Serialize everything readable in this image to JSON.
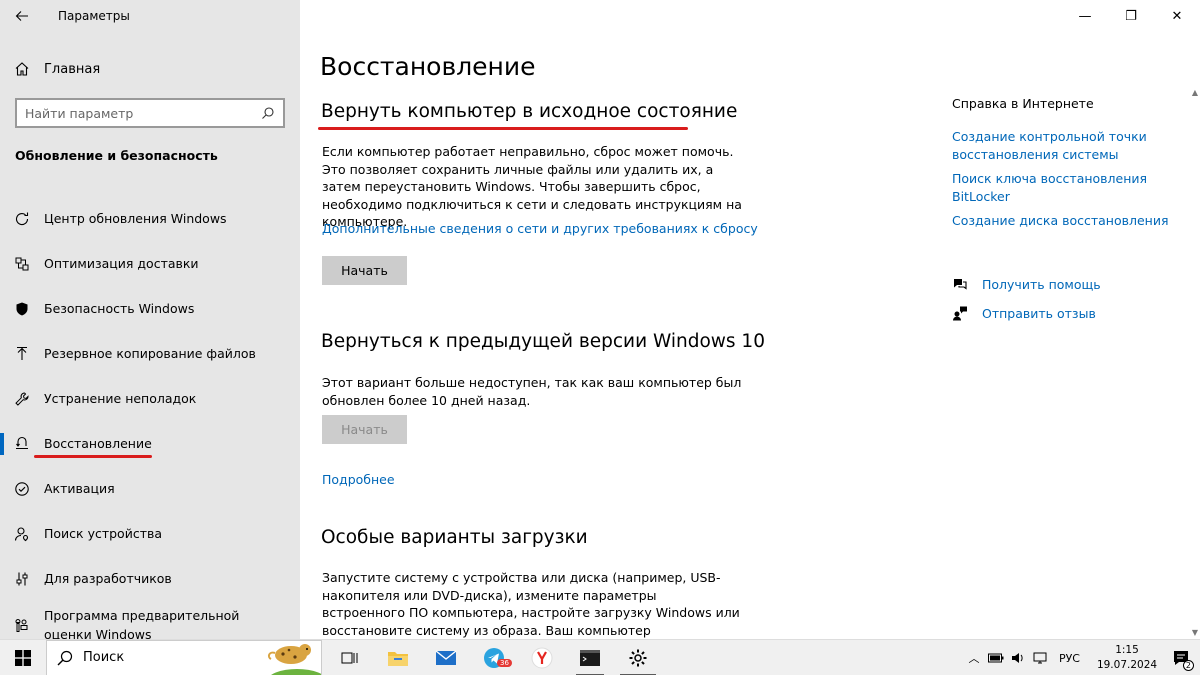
{
  "window": {
    "title": "Параметры",
    "controls": {
      "minimize": "—",
      "restore": "❐",
      "close": "✕"
    }
  },
  "sidebar": {
    "home_label": "Главная",
    "search_placeholder": "Найти параметр",
    "section_heading": "Обновление и безопасность",
    "items": [
      {
        "label": "Центр обновления Windows",
        "icon": "refresh-icon"
      },
      {
        "label": "Оптимизация доставки",
        "icon": "delivery-icon"
      },
      {
        "label": "Безопасность Windows",
        "icon": "shield-icon"
      },
      {
        "label": "Резервное копирование файлов",
        "icon": "backup-icon"
      },
      {
        "label": "Устранение неполадок",
        "icon": "wrench-icon"
      },
      {
        "label": "Восстановление",
        "icon": "recovery-icon",
        "active": true
      },
      {
        "label": "Активация",
        "icon": "check-circle-icon"
      },
      {
        "label": "Поиск устройства",
        "icon": "person-pin-icon"
      },
      {
        "label": "Для разработчиков",
        "icon": "sliders-icon"
      },
      {
        "label": "Программа предварительной оценки Windows",
        "icon": "insider-icon"
      }
    ]
  },
  "main": {
    "page_title": "Восстановление",
    "reset": {
      "heading": "Вернуть компьютер в исходное состояние",
      "description": "Если компьютер работает неправильно, сброс может помочь. Это позволяет сохранить личные файлы или удалить их, а затем переустановить Windows. Чтобы завершить сброс, необходимо подключиться к сети и следовать инструкциям на компьютере.",
      "link": "Дополнительные сведения о сети и других требованиях к сбросу",
      "button": "Начать"
    },
    "rollback": {
      "heading": "Вернуться к предыдущей версии Windows 10",
      "description": "Этот вариант больше недоступен, так как ваш компьютер был обновлен более 10 дней назад.",
      "button": "Начать",
      "link": "Подробнее"
    },
    "advanced": {
      "heading": "Особые варианты загрузки",
      "description": "Запустите систему с устройства или диска (например, USB-накопителя или DVD-диска), измените параметры встроенного ПО компьютера, настройте загрузку Windows или восстановите систему из образа. Ваш компьютер перезагрузится."
    }
  },
  "right_column": {
    "heading": "Справка в Интернете",
    "links": [
      "Создание контрольной точки восстановления системы",
      "Поиск ключа восстановления BitLocker",
      "Создание диска восстановления"
    ],
    "get_help": "Получить помощь",
    "feedback": "Отправить отзыв"
  },
  "taskbar": {
    "search_label": "Поиск",
    "telegram_badge": "36",
    "language": "РУС",
    "time": "1:15",
    "date": "19.07.2024",
    "notifications_badge": "2"
  },
  "colors": {
    "accent": "#0067c0",
    "link": "#0067b8",
    "annotation": "#d91c1c",
    "sidebar_bg": "#e6e6e6"
  }
}
